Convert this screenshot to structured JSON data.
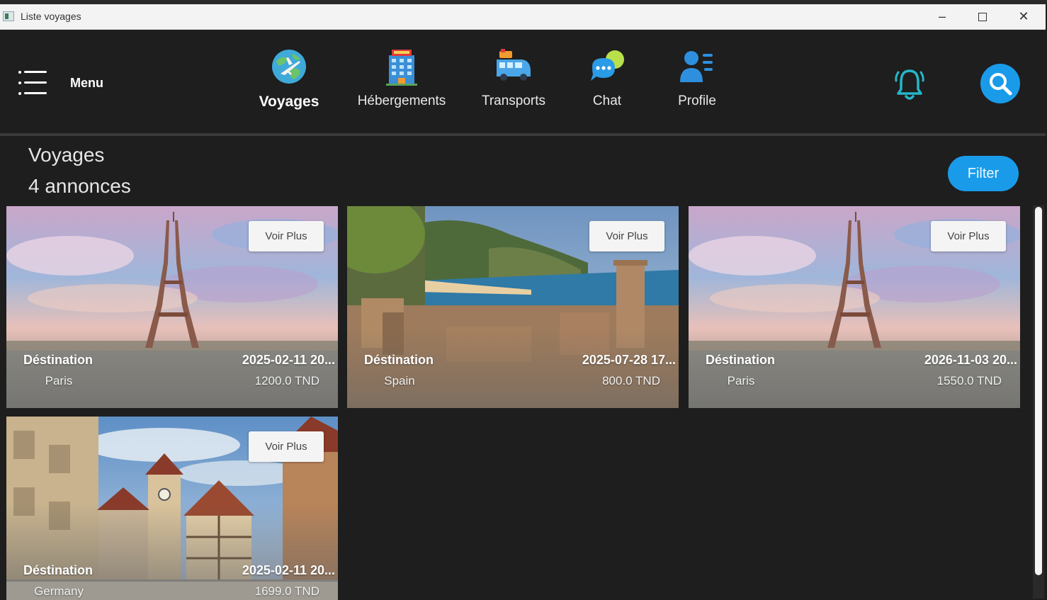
{
  "window": {
    "title": "Liste voyages",
    "minimize_glyph": "–",
    "close_glyph": "✕"
  },
  "navbar": {
    "menu_label": "Menu",
    "items": [
      {
        "label": "Voyages",
        "icon": "globe-plane-icon",
        "active": true
      },
      {
        "label": "Hébergements",
        "icon": "hotel-icon",
        "active": false
      },
      {
        "label": "Transports",
        "icon": "bus-icon",
        "active": false
      },
      {
        "label": "Chat",
        "icon": "chat-bubbles-icon",
        "active": false
      },
      {
        "label": "Profile",
        "icon": "user-profile-icon",
        "active": false
      }
    ],
    "notification_icon": "bell-icon",
    "search_icon": "search-icon",
    "accent_color": "#1a9bea"
  },
  "page": {
    "title": "Voyages",
    "count_text": "4 annonces",
    "filter_label": "Filter"
  },
  "cards": [
    {
      "button": "Voir Plus",
      "dest_label": "Déstination",
      "destination": "Paris",
      "date": "2025-02-11 20...",
      "price": "1200.0 TND",
      "scene": "eiffel-tower"
    },
    {
      "button": "Voir Plus",
      "dest_label": "Déstination",
      "destination": "Spain",
      "date": "2025-07-28 17...",
      "price": "800.0 TND",
      "scene": "coastal-bay"
    },
    {
      "button": "Voir Plus",
      "dest_label": "Déstination",
      "destination": "Paris",
      "date": "2026-11-03 20...",
      "price": "1550.0 TND",
      "scene": "eiffel-tower"
    },
    {
      "button": "Voir Plus",
      "dest_label": "Déstination",
      "destination": "Germany",
      "date": "2025-02-11 20...",
      "price": "1699.0 TND",
      "scene": "old-town"
    }
  ]
}
